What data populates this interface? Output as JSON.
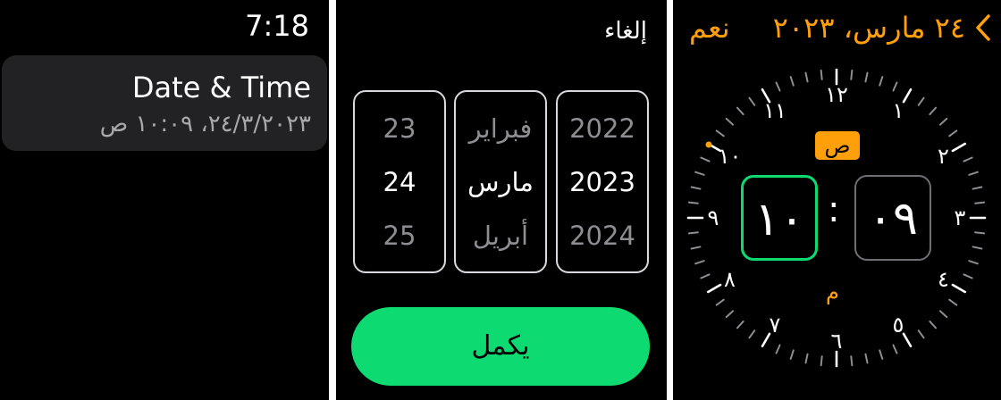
{
  "settings_screen": {
    "time": "7:18",
    "date_time_item": {
      "title": "Date & Time",
      "value": "٢٤/٣/٢٠٢٣، ١٠:٠٩ ص"
    }
  },
  "date_picker": {
    "cancel_label": "إلغاء",
    "day_column": {
      "prev": "23",
      "selected": "24",
      "next": "25"
    },
    "month_column": {
      "prev": "فبراير",
      "selected": "مارس",
      "next": "أبريل"
    },
    "year_column": {
      "prev": "2022",
      "selected": "2023",
      "next": "2024"
    },
    "done_label": "يكمل"
  },
  "time_picker": {
    "date_title": "٢٤ مارس، ٢٠٢٣",
    "confirm_label": "نعم",
    "am_label": "ص",
    "pm_label": "م",
    "hour_value": "١٠",
    "minute_value": "٠٩",
    "colon": ":",
    "dial_numbers": [
      "١٢",
      "١",
      "٢",
      "٣",
      "٤",
      "٥",
      "٦",
      "٧",
      "٨",
      "٩",
      "١٠",
      "١١"
    ],
    "icons": {
      "back": "chevron-left-icon",
      "active_marker": "dot-icon"
    },
    "colors": {
      "accent": "#ff9f0a",
      "selected_border": "#0ddb72",
      "done_button": "#0ddb72"
    }
  }
}
